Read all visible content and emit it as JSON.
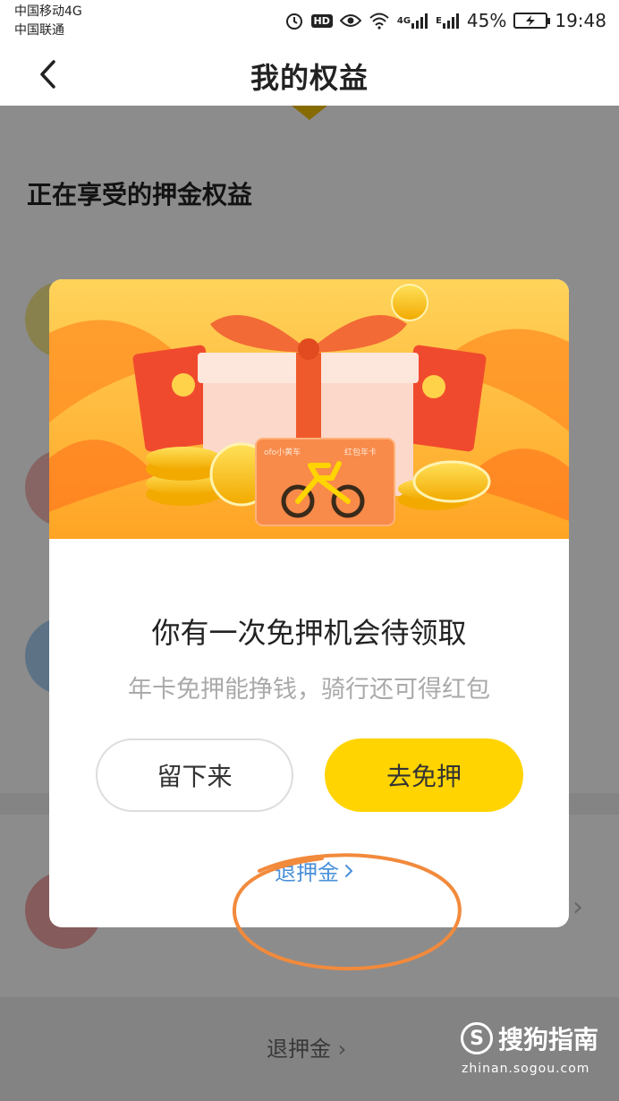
{
  "status_bar": {
    "carrier_1": "中国移动4G",
    "carrier_2": "中国联通",
    "hd": "HD",
    "net_1": "4G",
    "net_2": "E",
    "battery": "45%",
    "time": "19:48",
    "icons": [
      "alarm-icon",
      "eye-icon",
      "wifi-icon",
      "signal-icon",
      "charging-icon"
    ]
  },
  "nav": {
    "title": "我的权益",
    "back_icon": "chevron-left-icon"
  },
  "page": {
    "section_title": "正在享受的押金权益",
    "bottom_link": "退押金"
  },
  "modal": {
    "title": "你有一次免押机会待领取",
    "subtitle": "年卡免押能挣钱，骑行还可得红包",
    "stay_button": "留下来",
    "go_button": "去免押",
    "refund_link": "退押金",
    "hero": {
      "card_brand": "ofo小黄车",
      "card_label": "红包年卡"
    }
  },
  "watermark": {
    "logo_letter": "S",
    "name": "搜狗指南",
    "url": "zhinan.sogou.com"
  },
  "colors": {
    "accent_yellow": "#ffd400",
    "link_blue": "#4a90d9",
    "annotation_orange": "#f28a3c"
  }
}
